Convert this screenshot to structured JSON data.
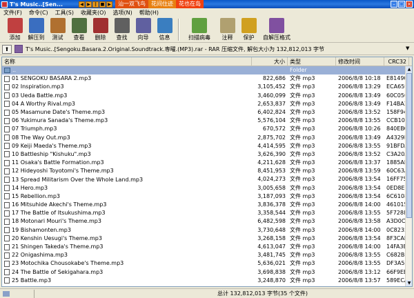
{
  "window": {
    "title": "T's Music..[Sen..."
  },
  "banner": [
    "汕一双飞鸟",
    "花间住迹",
    "花也在岛"
  ],
  "menu": [
    "文件(F)",
    "命令(C)",
    "工具(S)",
    "收藏夹(O)",
    "选项(N)",
    "帮助(H)"
  ],
  "toolbar": [
    {
      "label": "添加",
      "icon": "add-icon",
      "color": "#c04040"
    },
    {
      "label": "解压到",
      "icon": "extract-icon",
      "color": "#3a6ec0"
    },
    {
      "label": "测试",
      "icon": "test-icon",
      "color": "#b07030"
    },
    {
      "label": "查看",
      "icon": "view-icon",
      "color": "#507040"
    },
    {
      "label": "删除",
      "icon": "delete-icon",
      "color": "#a03030"
    },
    {
      "label": "查找",
      "icon": "find-icon",
      "color": "#606060"
    },
    {
      "label": "向导",
      "icon": "wizard-icon",
      "color": "#6060a0"
    },
    {
      "label": "信息",
      "icon": "info-icon",
      "color": "#3a7ec0"
    },
    {
      "label": "扫描病毒",
      "icon": "virus-scan-icon",
      "color": "#60a040"
    },
    {
      "label": "注释",
      "icon": "comment-icon",
      "color": "#b0a070"
    },
    {
      "label": "保护",
      "icon": "protect-icon",
      "color": "#d0a020"
    },
    {
      "label": "自解压格式",
      "icon": "sfx-icon",
      "color": "#8050a0"
    }
  ],
  "address": {
    "path": "T's Music..[Sengoku.Basara.2.Original.Soundtrack.専曜.(MP3).rar - RAR 压缩文件, 解包大小为 132,812,013 字节"
  },
  "columns": {
    "name": "名称",
    "size": "大小",
    "type": "类型",
    "modified": "修改时间",
    "crc": "CRC32"
  },
  "parent_row": {
    "name": "..",
    "type": "Folder"
  },
  "files": [
    {
      "name": "01 SENGOKU BASARA 2.mp3",
      "size": "822,686",
      "type": "文件 mp3",
      "modified": "2006/8/8 10:18",
      "crc": "E8149C30"
    },
    {
      "name": "02 Inspiration.mp3",
      "size": "3,105,452",
      "type": "文件 mp3",
      "modified": "2006/8/8 13:29",
      "crc": "ECA659..."
    },
    {
      "name": "03 Ueda Battle.mp3",
      "size": "3,460,099",
      "type": "文件 mp3",
      "modified": "2006/8/8 13:49",
      "crc": "60C05022"
    },
    {
      "name": "04 A Worthy Rival.mp3",
      "size": "2,653,837",
      "type": "文件 mp3",
      "modified": "2006/8/8 13:49",
      "crc": "F14BA32B"
    },
    {
      "name": "05 Masamune Date's Theme.mp3",
      "size": "6,402,824",
      "type": "文件 mp3",
      "modified": "2006/8/8 13:52",
      "crc": "158F945C"
    },
    {
      "name": "06 Yukimura Sanada's Theme.mp3",
      "size": "5,576,104",
      "type": "文件 mp3",
      "modified": "2006/8/8 13:55",
      "crc": "CCB10F75"
    },
    {
      "name": "07 Triumph.mp3",
      "size": "670,572",
      "type": "文件 mp3",
      "modified": "2006/8/8 10:26",
      "crc": "840EBC..."
    },
    {
      "name": "08 The Way Out.mp3",
      "size": "2,875,702",
      "type": "文件 mp3",
      "modified": "2006/8/8 13:49",
      "crc": "A4329FA4"
    },
    {
      "name": "09 Keiji Maeda's Theme.mp3",
      "size": "4,414,595",
      "type": "文件 mp3",
      "modified": "2006/8/8 13:55",
      "crc": "91BFDA..."
    },
    {
      "name": "10 Battleship \"Kishuku\".mp3",
      "size": "3,626,390",
      "type": "文件 mp3",
      "modified": "2006/8/8 13:52",
      "crc": "C3A20A..."
    },
    {
      "name": "11 Osaka's Battle Formation.mp3",
      "size": "4,211,628",
      "type": "文件 mp3",
      "modified": "2006/8/8 13:37",
      "crc": "1885AE80"
    },
    {
      "name": "12 Hideyoshi Toyotomi's Theme.mp3",
      "size": "8,451,953",
      "type": "文件 mp3",
      "modified": "2006/8/8 13:59",
      "crc": "60C63AE6"
    },
    {
      "name": "13 Spread Militarism Over the Whole Land.mp3",
      "size": "4,024,273",
      "type": "文件 mp3",
      "modified": "2006/8/8 13:54",
      "crc": "16FF75E1"
    },
    {
      "name": "14 Hero.mp3",
      "size": "3,005,658",
      "type": "文件 mp3",
      "modified": "2006/8/8 13:54",
      "crc": "0ED8E380"
    },
    {
      "name": "15 Rebellion.mp3",
      "size": "3,187,093",
      "type": "文件 mp3",
      "modified": "2006/8/8 13:54",
      "crc": "6C610895"
    },
    {
      "name": "16 Mitsuhide Akechi's Theme.mp3",
      "size": "3,836,378",
      "type": "文件 mp3",
      "modified": "2006/8/8 14:00",
      "crc": "4610159E"
    },
    {
      "name": "17 The Battle of Itsukushima.mp3",
      "size": "3,358,544",
      "type": "文件 mp3",
      "modified": "2006/8/8 13:55",
      "crc": "5F72886F"
    },
    {
      "name": "18 Motonari Mouri's Theme.mp3",
      "size": "6,482,598",
      "type": "文件 mp3",
      "modified": "2006/8/8 13:58",
      "crc": "A3D0CA..."
    },
    {
      "name": "19 Bishamonten.mp3",
      "size": "3,730,648",
      "type": "文件 mp3",
      "modified": "2006/8/8 14:00",
      "crc": "0C823548"
    },
    {
      "name": "20 Kenshin Uesugi's Theme.mp3",
      "size": "3,268,158",
      "type": "文件 mp3",
      "modified": "2006/8/8 13:54",
      "crc": "8F3CAE..."
    },
    {
      "name": "21 Shingen Takeda's Theme.mp3",
      "size": "4,613,047",
      "type": "文件 mp3",
      "modified": "2006/8/8 14:00",
      "crc": "14FA3BF8"
    },
    {
      "name": "22 Onigashima.mp3",
      "size": "3,481,745",
      "type": "文件 mp3",
      "modified": "2006/8/8 13:55",
      "crc": "C682B093"
    },
    {
      "name": "23 Motochika Chousokabe's Theme.mp3",
      "size": "5,636,021",
      "type": "文件 mp3",
      "modified": "2006/8/8 13:55",
      "crc": "DF3A5369"
    },
    {
      "name": "24 The Battle of Sekigahara.mp3",
      "size": "3,698,838",
      "type": "文件 mp3",
      "modified": "2006/8/8 13:12",
      "crc": "66F9EB56"
    },
    {
      "name": "25 Battle.mp3",
      "size": "3,248,870",
      "type": "文件 mp3",
      "modified": "2006/8/8 13:57",
      "crc": "589ECA..."
    }
  ],
  "status": {
    "total": "总计 132,812,013 字节(35 个文件)"
  }
}
